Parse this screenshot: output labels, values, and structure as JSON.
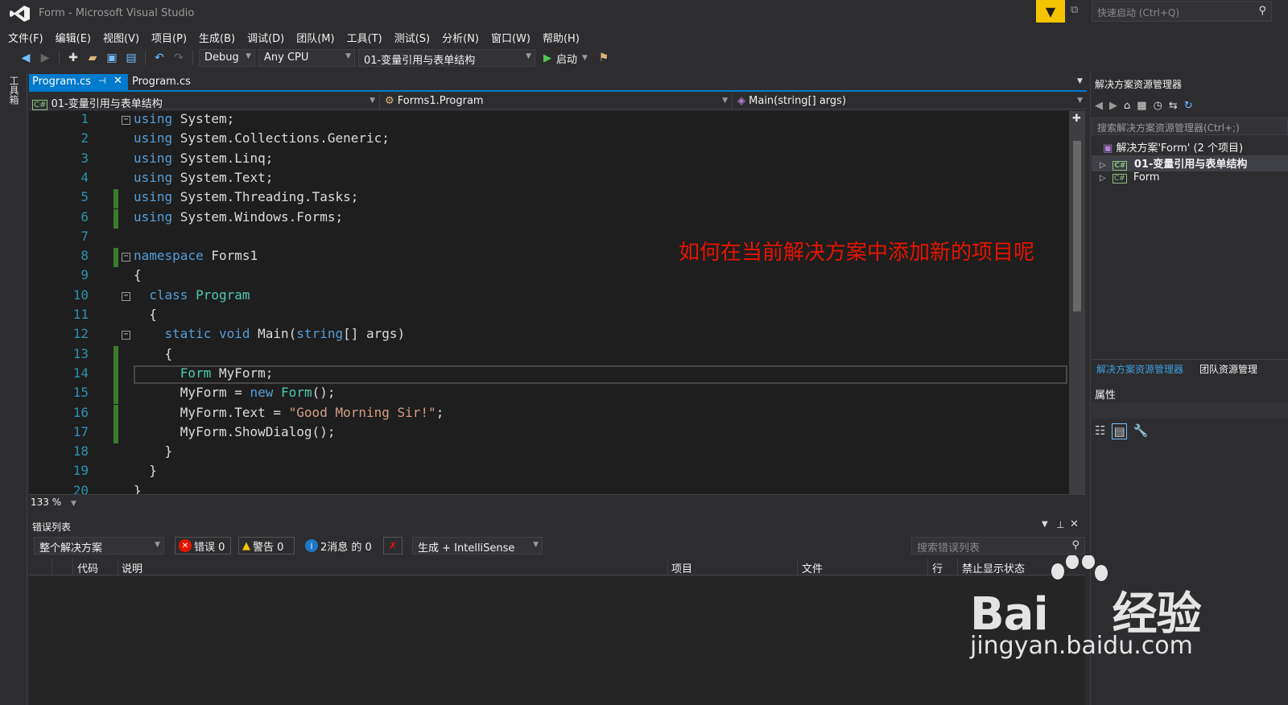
{
  "window": {
    "title": "Form - Microsoft Visual Studio",
    "quick_launch_placeholder": "快速启动 (Ctrl+Q)"
  },
  "menu": [
    "文件(F)",
    "编辑(E)",
    "视图(V)",
    "项目(P)",
    "生成(B)",
    "调试(D)",
    "团队(M)",
    "工具(T)",
    "测试(S)",
    "分析(N)",
    "窗口(W)",
    "帮助(H)"
  ],
  "toolbar": {
    "config": "Debug",
    "platform": "Any CPU",
    "startup_project": "01-变量引用与表单结构",
    "start_label": "启动"
  },
  "toolbox_label": "工具箱",
  "tabs": [
    {
      "label": "Program.cs",
      "active": true
    },
    {
      "label": "Program.cs",
      "active": false
    }
  ],
  "navbar": {
    "project": "01-变量引用与表单结构",
    "class": "Forms1.Program",
    "member": "Main(string[] args)"
  },
  "editor": {
    "zoom": "133 %",
    "annotation": "如何在当前解决方案中添加新的项目呢",
    "lines": [
      {
        "n": "1",
        "tokens": [
          [
            "kw",
            "using"
          ],
          [
            "",
            " System;"
          ]
        ]
      },
      {
        "n": "2",
        "tokens": [
          [
            "kw",
            "using"
          ],
          [
            "",
            " System.Collections.Generic;"
          ]
        ]
      },
      {
        "n": "3",
        "tokens": [
          [
            "kw",
            "using"
          ],
          [
            "",
            " System.Linq;"
          ]
        ]
      },
      {
        "n": "4",
        "tokens": [
          [
            "kw",
            "using"
          ],
          [
            "",
            " System.Text;"
          ]
        ]
      },
      {
        "n": "5",
        "tokens": [
          [
            "kw",
            "using"
          ],
          [
            "",
            " System.Threading.Tasks;"
          ]
        ]
      },
      {
        "n": "6",
        "tokens": [
          [
            "kw",
            "using"
          ],
          [
            "",
            " System.Windows.Forms;"
          ]
        ]
      },
      {
        "n": "7",
        "tokens": []
      },
      {
        "n": "8",
        "tokens": [
          [
            "kw",
            "namespace"
          ],
          [
            "",
            " Forms1"
          ]
        ]
      },
      {
        "n": "9",
        "tokens": [
          [
            "",
            "{"
          ]
        ]
      },
      {
        "n": "10",
        "tokens": [
          [
            "",
            "  "
          ],
          [
            "kw",
            "class"
          ],
          [
            "",
            " "
          ],
          [
            "ty",
            "Program"
          ]
        ]
      },
      {
        "n": "11",
        "tokens": [
          [
            "",
            "  {"
          ]
        ]
      },
      {
        "n": "12",
        "tokens": [
          [
            "",
            "    "
          ],
          [
            "kw",
            "static"
          ],
          [
            "",
            " "
          ],
          [
            "kw",
            "void"
          ],
          [
            "",
            " Main("
          ],
          [
            "kw",
            "string"
          ],
          [
            "",
            "[] args)"
          ]
        ]
      },
      {
        "n": "13",
        "tokens": [
          [
            "",
            "    {"
          ]
        ]
      },
      {
        "n": "14",
        "tokens": [
          [
            "",
            "      "
          ],
          [
            "ty",
            "Form"
          ],
          [
            "",
            " MyForm;"
          ]
        ]
      },
      {
        "n": "15",
        "tokens": [
          [
            "",
            "      MyForm = "
          ],
          [
            "kw",
            "new"
          ],
          [
            "",
            " "
          ],
          [
            "ty",
            "Form"
          ],
          [
            "",
            "();"
          ]
        ]
      },
      {
        "n": "16",
        "tokens": [
          [
            "",
            "      MyForm.Text = "
          ],
          [
            "st",
            "\"Good Morning Sir!\""
          ],
          [
            "",
            ";"
          ]
        ]
      },
      {
        "n": "17",
        "tokens": [
          [
            "",
            "      MyForm.ShowDialog();"
          ]
        ]
      },
      {
        "n": "18",
        "tokens": [
          [
            "",
            "    }"
          ]
        ]
      },
      {
        "n": "19",
        "tokens": [
          [
            "",
            "  }"
          ]
        ]
      },
      {
        "n": "20",
        "tokens": [
          [
            "",
            "}"
          ]
        ]
      }
    ]
  },
  "error_list": {
    "title": "错误列表",
    "scope": "整个解决方案",
    "errors": "错误 0",
    "warnings": "警告 0",
    "messages": "2消息 的 0",
    "source": "生成 + IntelliSense",
    "search_placeholder": "搜索错误列表",
    "columns": [
      "代码",
      "说明",
      "项目",
      "文件",
      "行",
      "禁止显示状态"
    ]
  },
  "solution_explorer": {
    "title": "解决方案资源管理器",
    "search_placeholder": "搜索解决方案资源管理器(Ctrl+;)",
    "solution": "解决方案'Form' (2 个项目)",
    "projects": [
      "01-变量引用与表单结构",
      "Form"
    ],
    "tabs": [
      "解决方案资源管理器",
      "团队资源管理"
    ]
  },
  "properties": {
    "title": "属性"
  },
  "watermark": {
    "brand": "Bai",
    "brand2": "经验",
    "url": "jingyan.baidu.com"
  },
  "colors": {
    "accent": "#007acc",
    "annotation": "#e51400",
    "keyword": "#569cd6",
    "type": "#4ec9b0",
    "string": "#d69d85"
  }
}
